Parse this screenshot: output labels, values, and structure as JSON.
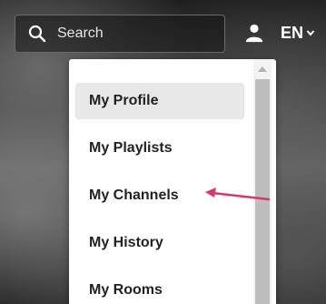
{
  "header": {
    "search": {
      "placeholder": "Search",
      "icon": "search-icon"
    },
    "user": {
      "icon": "user-icon"
    },
    "language": {
      "label": "EN",
      "icon": "chevron-down-icon"
    }
  },
  "dropdown": {
    "items": [
      {
        "label": "My Profile",
        "active": true
      },
      {
        "label": "My Playlists",
        "active": false
      },
      {
        "label": "My Channels",
        "active": false
      },
      {
        "label": "My History",
        "active": false
      },
      {
        "label": "My Rooms",
        "active": false
      }
    ],
    "scroll_up_icon": "scroll-up-arrow-icon"
  },
  "annotation": {
    "icon": "pointer-arrow-icon",
    "color": "#d9386b",
    "points_to": "My Channels"
  },
  "colors": {
    "menu_hover": "#e8e8e8",
    "menu_text": "#222222",
    "header_text": "#ffffff"
  }
}
